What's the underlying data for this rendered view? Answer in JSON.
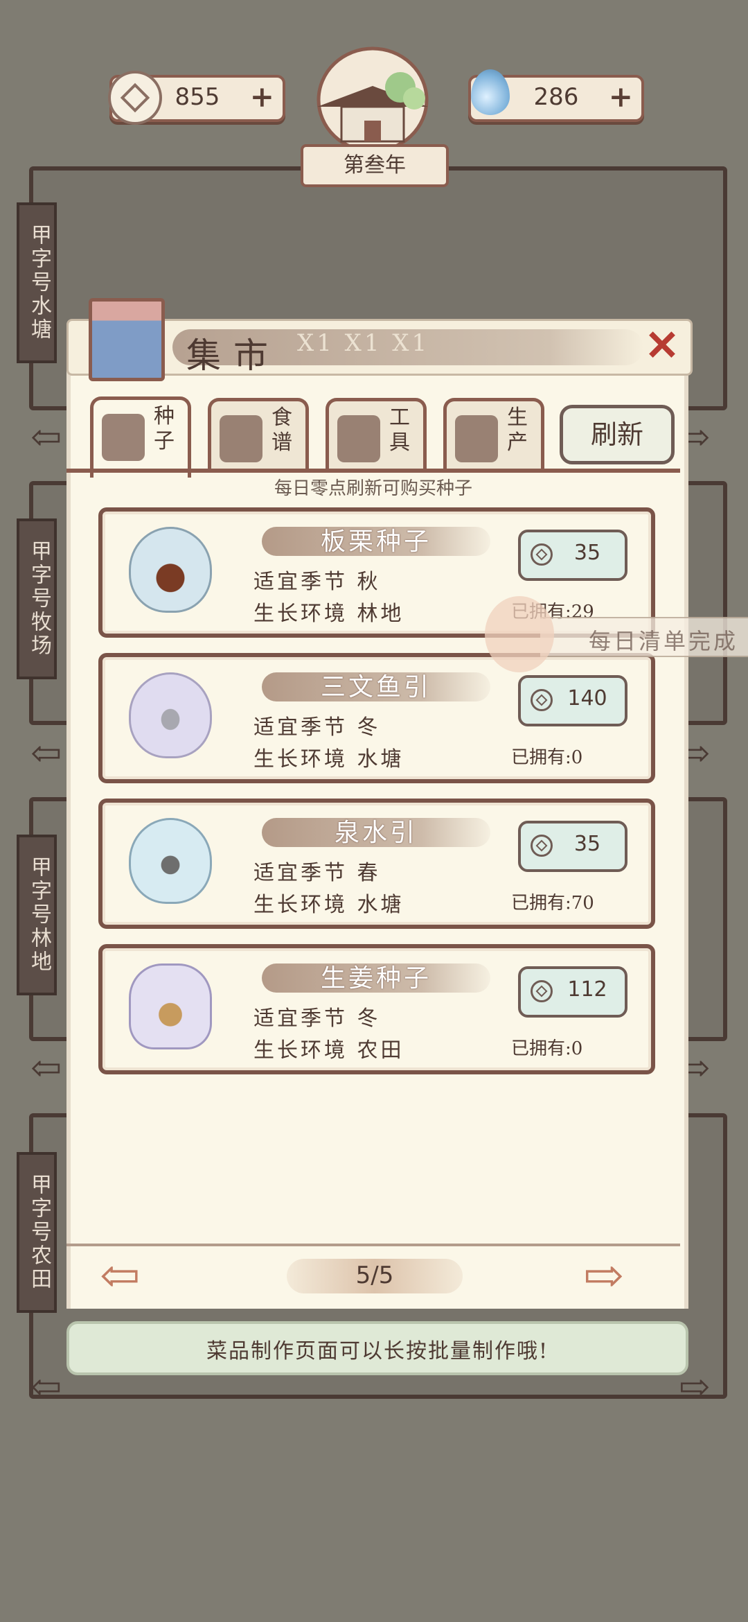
{
  "top_bar": {
    "coins": "855",
    "jade": "286",
    "year": "第叁年",
    "plus_symbol": "+"
  },
  "side_tags": [
    "甲字号水塘",
    "甲字号牧场",
    "甲字号林地",
    "甲字号农田"
  ],
  "panel": {
    "title": "集市",
    "counts": "X1 X1 X1",
    "close": "✕",
    "tabs": [
      {
        "label": "种子",
        "icon": "seed-bag-icon"
      },
      {
        "label": "食谱",
        "icon": "recipe-book-icon"
      },
      {
        "label": "工具",
        "icon": "tool-icon"
      },
      {
        "label": "生产",
        "icon": "production-icon"
      }
    ],
    "refresh": "刷新",
    "notice": "每日零点刷新可购买种子"
  },
  "items": [
    {
      "name": "板栗种子",
      "season": "适宜季节 秋",
      "env": "生长环境 林地",
      "price": "35",
      "owned": "已拥有:29",
      "icon": "chestnut-seed-icon"
    },
    {
      "name": "三文鱼引",
      "season": "适宜季节 冬",
      "env": "生长环境 水塘",
      "price": "140",
      "owned": "已拥有:0",
      "icon": "salmon-fishbowl-icon"
    },
    {
      "name": "泉水引",
      "season": "适宜季节 春",
      "env": "生长环境 水塘",
      "price": "35",
      "owned": "已拥有:70",
      "icon": "spring-water-bowl-icon"
    },
    {
      "name": "生姜种子",
      "season": "适宜季节 冬",
      "env": "生长环境 农田",
      "price": "112",
      "owned": "已拥有:0",
      "icon": "ginger-seed-bag-icon"
    }
  ],
  "pager": {
    "text": "5/5",
    "prev": "⇦",
    "next": "⇨"
  },
  "tip": "菜品制作页面可以长按批量制作哦!",
  "daily_banner": "每日清单完成",
  "colors": {
    "background": "#7f7c72",
    "panel": "#fbf7e8",
    "frame": "#7a5448",
    "close": "#b73b32"
  }
}
